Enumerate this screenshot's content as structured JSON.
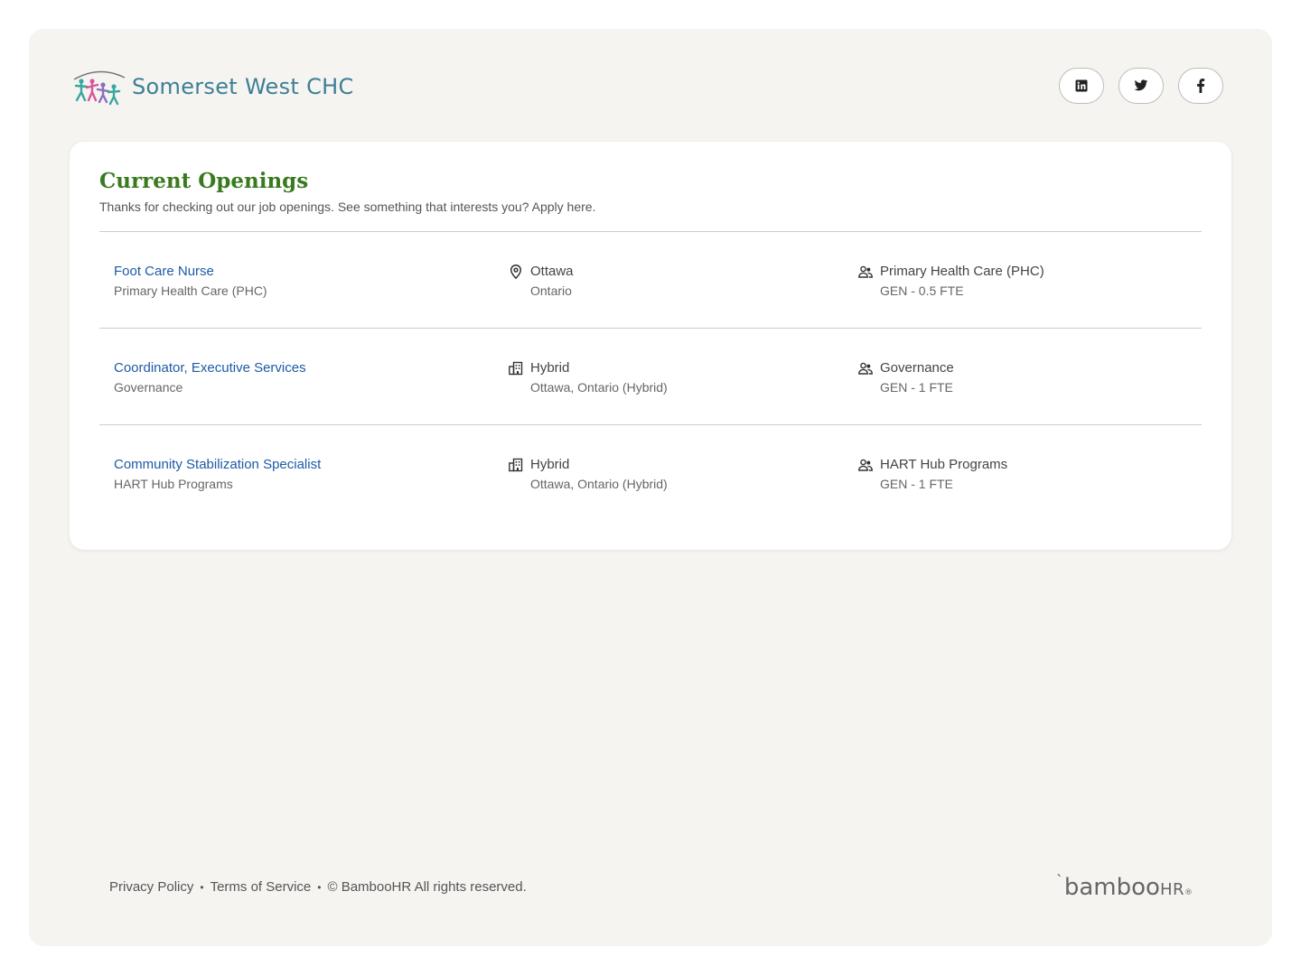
{
  "brand": {
    "name": "Somerset West CHC",
    "colors": {
      "logo_text": "#3d7f95",
      "heading": "#3a7a1f",
      "link": "#1e5aa6"
    }
  },
  "social": [
    {
      "name": "linkedin-icon"
    },
    {
      "name": "twitter-icon"
    },
    {
      "name": "facebook-icon"
    }
  ],
  "openings": {
    "title": "Current Openings",
    "subtitle": "Thanks for checking out our job openings. See something that interests you? Apply here.",
    "jobs": [
      {
        "title": "Foot Care Nurse",
        "department_sub": "Primary Health Care (PHC)",
        "location_icon": "map-pin-icon",
        "location_main": "Ottawa",
        "location_sub": "Ontario",
        "dept_icon": "people-icon",
        "dept_main": "Primary Health Care (PHC)",
        "dept_sub": "GEN - 0.5 FTE"
      },
      {
        "title": "Coordinator, Executive Services",
        "department_sub": "Governance",
        "location_icon": "building-icon",
        "location_main": "Hybrid",
        "location_sub": "Ottawa, Ontario (Hybrid)",
        "dept_icon": "people-icon",
        "dept_main": "Governance",
        "dept_sub": "GEN - 1 FTE"
      },
      {
        "title": "Community Stabilization Specialist",
        "department_sub": "HART Hub Programs",
        "location_icon": "building-icon",
        "location_main": "Hybrid",
        "location_sub": "Ottawa, Ontario (Hybrid)",
        "dept_icon": "people-icon",
        "dept_main": "HART Hub Programs",
        "dept_sub": "GEN - 1 FTE"
      }
    ]
  },
  "footer": {
    "privacy": "Privacy Policy",
    "terms": "Terms of Service",
    "copyright": "© BambooHR All rights reserved.",
    "bamboo_word": "bamboo",
    "bamboo_hr": "HR",
    "bamboo_tm": "®"
  }
}
